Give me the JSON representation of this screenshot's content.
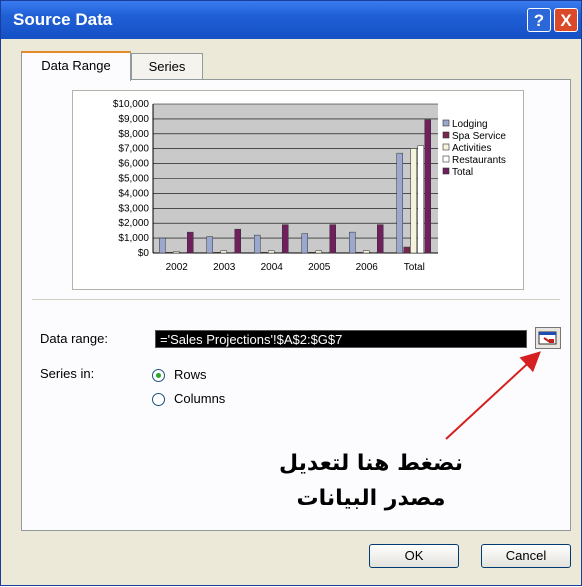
{
  "window": {
    "title": "Source Data",
    "help_glyph": "?",
    "close_glyph": "X"
  },
  "tabs": [
    {
      "label": "Data Range",
      "active": true
    },
    {
      "label": "Series",
      "active": false
    }
  ],
  "chart_data": {
    "type": "bar",
    "categories": [
      "2002",
      "2003",
      "2004",
      "2005",
      "2006",
      "Total"
    ],
    "series": [
      {
        "name": "Lodging",
        "color": "#9aa8cf",
        "values": [
          1000,
          1100,
          1200,
          1300,
          1400,
          6700
        ]
      },
      {
        "name": "Spa Service",
        "color": "#7a2550",
        "values": [
          50,
          50,
          50,
          50,
          50,
          400
        ]
      },
      {
        "name": "Activities",
        "color": "#f5f3dc",
        "values": [
          100,
          150,
          150,
          150,
          150,
          7000
        ]
      },
      {
        "name": "Restaurants",
        "color": "#ffffff",
        "values": [
          50,
          50,
          50,
          50,
          50,
          7200
        ]
      },
      {
        "name": "Total",
        "color": "#6e1f5c",
        "values": [
          1400,
          1600,
          1900,
          1900,
          1900,
          8950
        ]
      }
    ],
    "yticks": [
      "$0",
      "$1,000",
      "$2,000",
      "$3,000",
      "$4,000",
      "$5,000",
      "$6,000",
      "$7,000",
      "$8,000",
      "$9,000",
      "$10,000"
    ],
    "ylim": [
      0,
      10000
    ],
    "grid": true,
    "legend": "right"
  },
  "form": {
    "data_range_label": "Data range:",
    "data_range_value": "='Sales Projections'!$A$2:$G$7",
    "series_in_label": "Series in:",
    "rows_label": "Rows",
    "columns_label": "Columns",
    "selected": "Rows"
  },
  "annotation": {
    "line1": "نضغط هنا لتعديل",
    "line2": "مصدر البيانات",
    "arrow_color": "#d42020"
  },
  "buttons": {
    "ok": "OK",
    "cancel": "Cancel"
  }
}
